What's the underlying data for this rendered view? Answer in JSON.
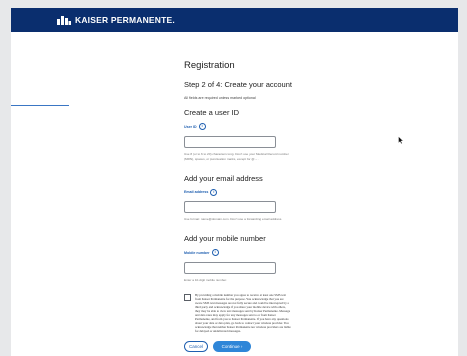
{
  "header": {
    "brand": "KAISER PERMANENTE."
  },
  "page": {
    "title": "Registration",
    "step": "Step 2 of 4: Create your account",
    "required_note": "All fields are required unless marked optional"
  },
  "user_id": {
    "section": "Create a user ID",
    "label": "User ID",
    "value": "",
    "help": "Use 8 (or to 6 to 20) characters long. Don't use your Medical Record number (MRN), spaces, or punctuation marks, except for @ – ."
  },
  "email": {
    "section": "Add your email address",
    "label": "Email address",
    "value": "",
    "help": "Use format: name@domain.com. Don't use a forwarding email address."
  },
  "mobile": {
    "section": "Add your mobile number",
    "label": "Mobile number",
    "value": "",
    "help": "Enter a 10-digit mobile number."
  },
  "consent": {
    "checked": false,
    "text": "By providing a mobile number you agree to receive at least one SMS text from Kaiser Permanente for the purpose. You acknowledge that you are aware SMS text messages are not fully secure and could be intercepted by a third party and acknowledge if you share your mobile device with others, they may be able to view text messages sent by Kaiser Permanente. Message and data rates may apply for any messages sent to or from Kaiser Permanente, and from you to Kaiser Permanente. If you have any questions about your data or data plan, go back to contact your wireless provider. You acknowledge that neither Kaiser Permanente nor wireless providers are liable for delayed or undelivered messages."
  },
  "buttons": {
    "cancel": "Cancel",
    "continue": "Continue ›"
  },
  "colors": {
    "header": "#0a2e6e",
    "accent": "#2f86d8",
    "link": "#1f5fb0"
  }
}
